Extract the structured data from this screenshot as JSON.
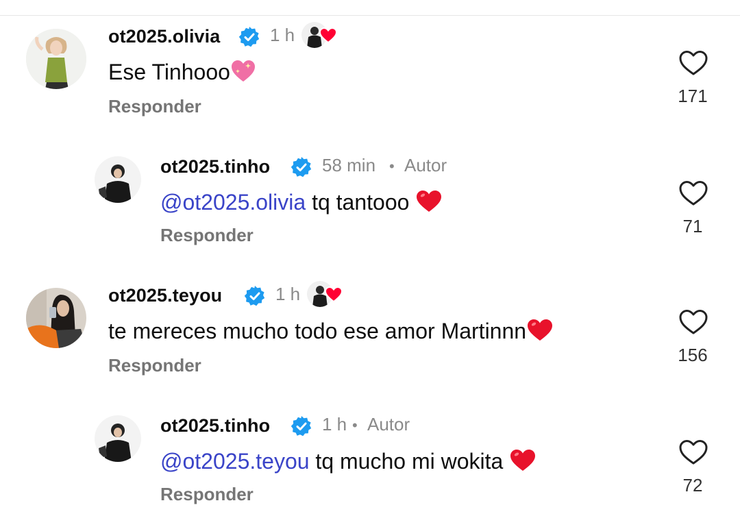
{
  "comments": [
    {
      "username": "ot2025.olivia",
      "time": "1 h",
      "author_badge": "",
      "text": "Ese Tinhooo",
      "mention": "",
      "emoji": "sparkling-heart-icon",
      "reply_label": "Responder",
      "like_count": "171",
      "liked_by_creator": true
    },
    {
      "username": "ot2025.tinho",
      "time": "58 min",
      "author_badge": "Autor",
      "text": " tq tantooo ",
      "mention": "@ot2025.olivia",
      "emoji": "red-heart-icon",
      "reply_label": "Responder",
      "like_count": "71",
      "liked_by_creator": false
    },
    {
      "username": "ot2025.teyou",
      "time": "1 h",
      "author_badge": "",
      "text": "te mereces mucho todo ese amor Martinnn",
      "mention": "",
      "emoji": "red-heart-icon",
      "reply_label": "Responder",
      "like_count": "156",
      "liked_by_creator": true
    },
    {
      "username": "ot2025.tinho",
      "time": "1 h",
      "author_badge": "Autor",
      "text": " tq mucho mi wokita ",
      "mention": "@ot2025.teyou",
      "emoji": "red-heart-icon",
      "reply_label": "Responder",
      "like_count": "72",
      "liked_by_creator": false
    }
  ],
  "separator": "•",
  "colors": {
    "mention": "#3a44c8",
    "verified": "#1d9bf0",
    "secondary_text": "#8a8a8a",
    "heart_red": "#e8122b"
  }
}
